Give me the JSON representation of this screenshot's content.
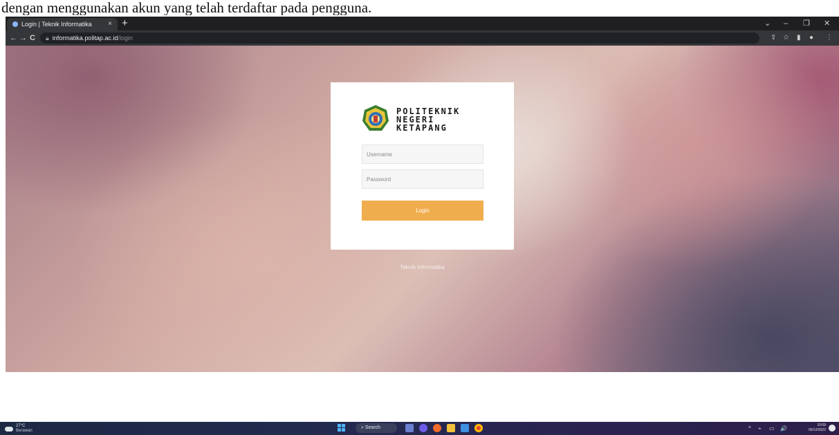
{
  "document": {
    "text": "dengan menggunakan akun yang telah terdaftar pada pengguna."
  },
  "browser": {
    "tab": {
      "title": "Login | Teknik Informatika",
      "close": "×"
    },
    "new_tab": "+",
    "window_controls": {
      "dropdown": "⌄",
      "minimize": "–",
      "restore": "❐",
      "close": "✕"
    },
    "nav": {
      "back": "←",
      "forward": "→",
      "reload": "C"
    },
    "address": {
      "host": "informatika.politap.ac.id",
      "path": "/login"
    },
    "toolbar_icons": {
      "share": "⇪",
      "bookmark": "☆",
      "sidebar": "▮",
      "profile": "●",
      "menu": "⋮"
    }
  },
  "page": {
    "logo": {
      "line1": "POLITEKNIK",
      "line2": "NEGERI",
      "line3": "KETAPANG"
    },
    "form": {
      "username_placeholder": "Username",
      "password_placeholder": "Password",
      "login_label": "Login"
    },
    "footer": "Teknik Informatika"
  },
  "taskbar": {
    "weather": {
      "temp": "27°C",
      "condition": "Berawan"
    },
    "search_label": "Search",
    "clock": {
      "time": "10:09",
      "date": "05/12/2022"
    },
    "tray": {
      "chevron": "^",
      "network": "⌁",
      "volume": "🔊"
    }
  },
  "colors": {
    "login_button": "#f0ad4e",
    "browser_frame": "#35363a",
    "taskbar": "#232a4f"
  }
}
